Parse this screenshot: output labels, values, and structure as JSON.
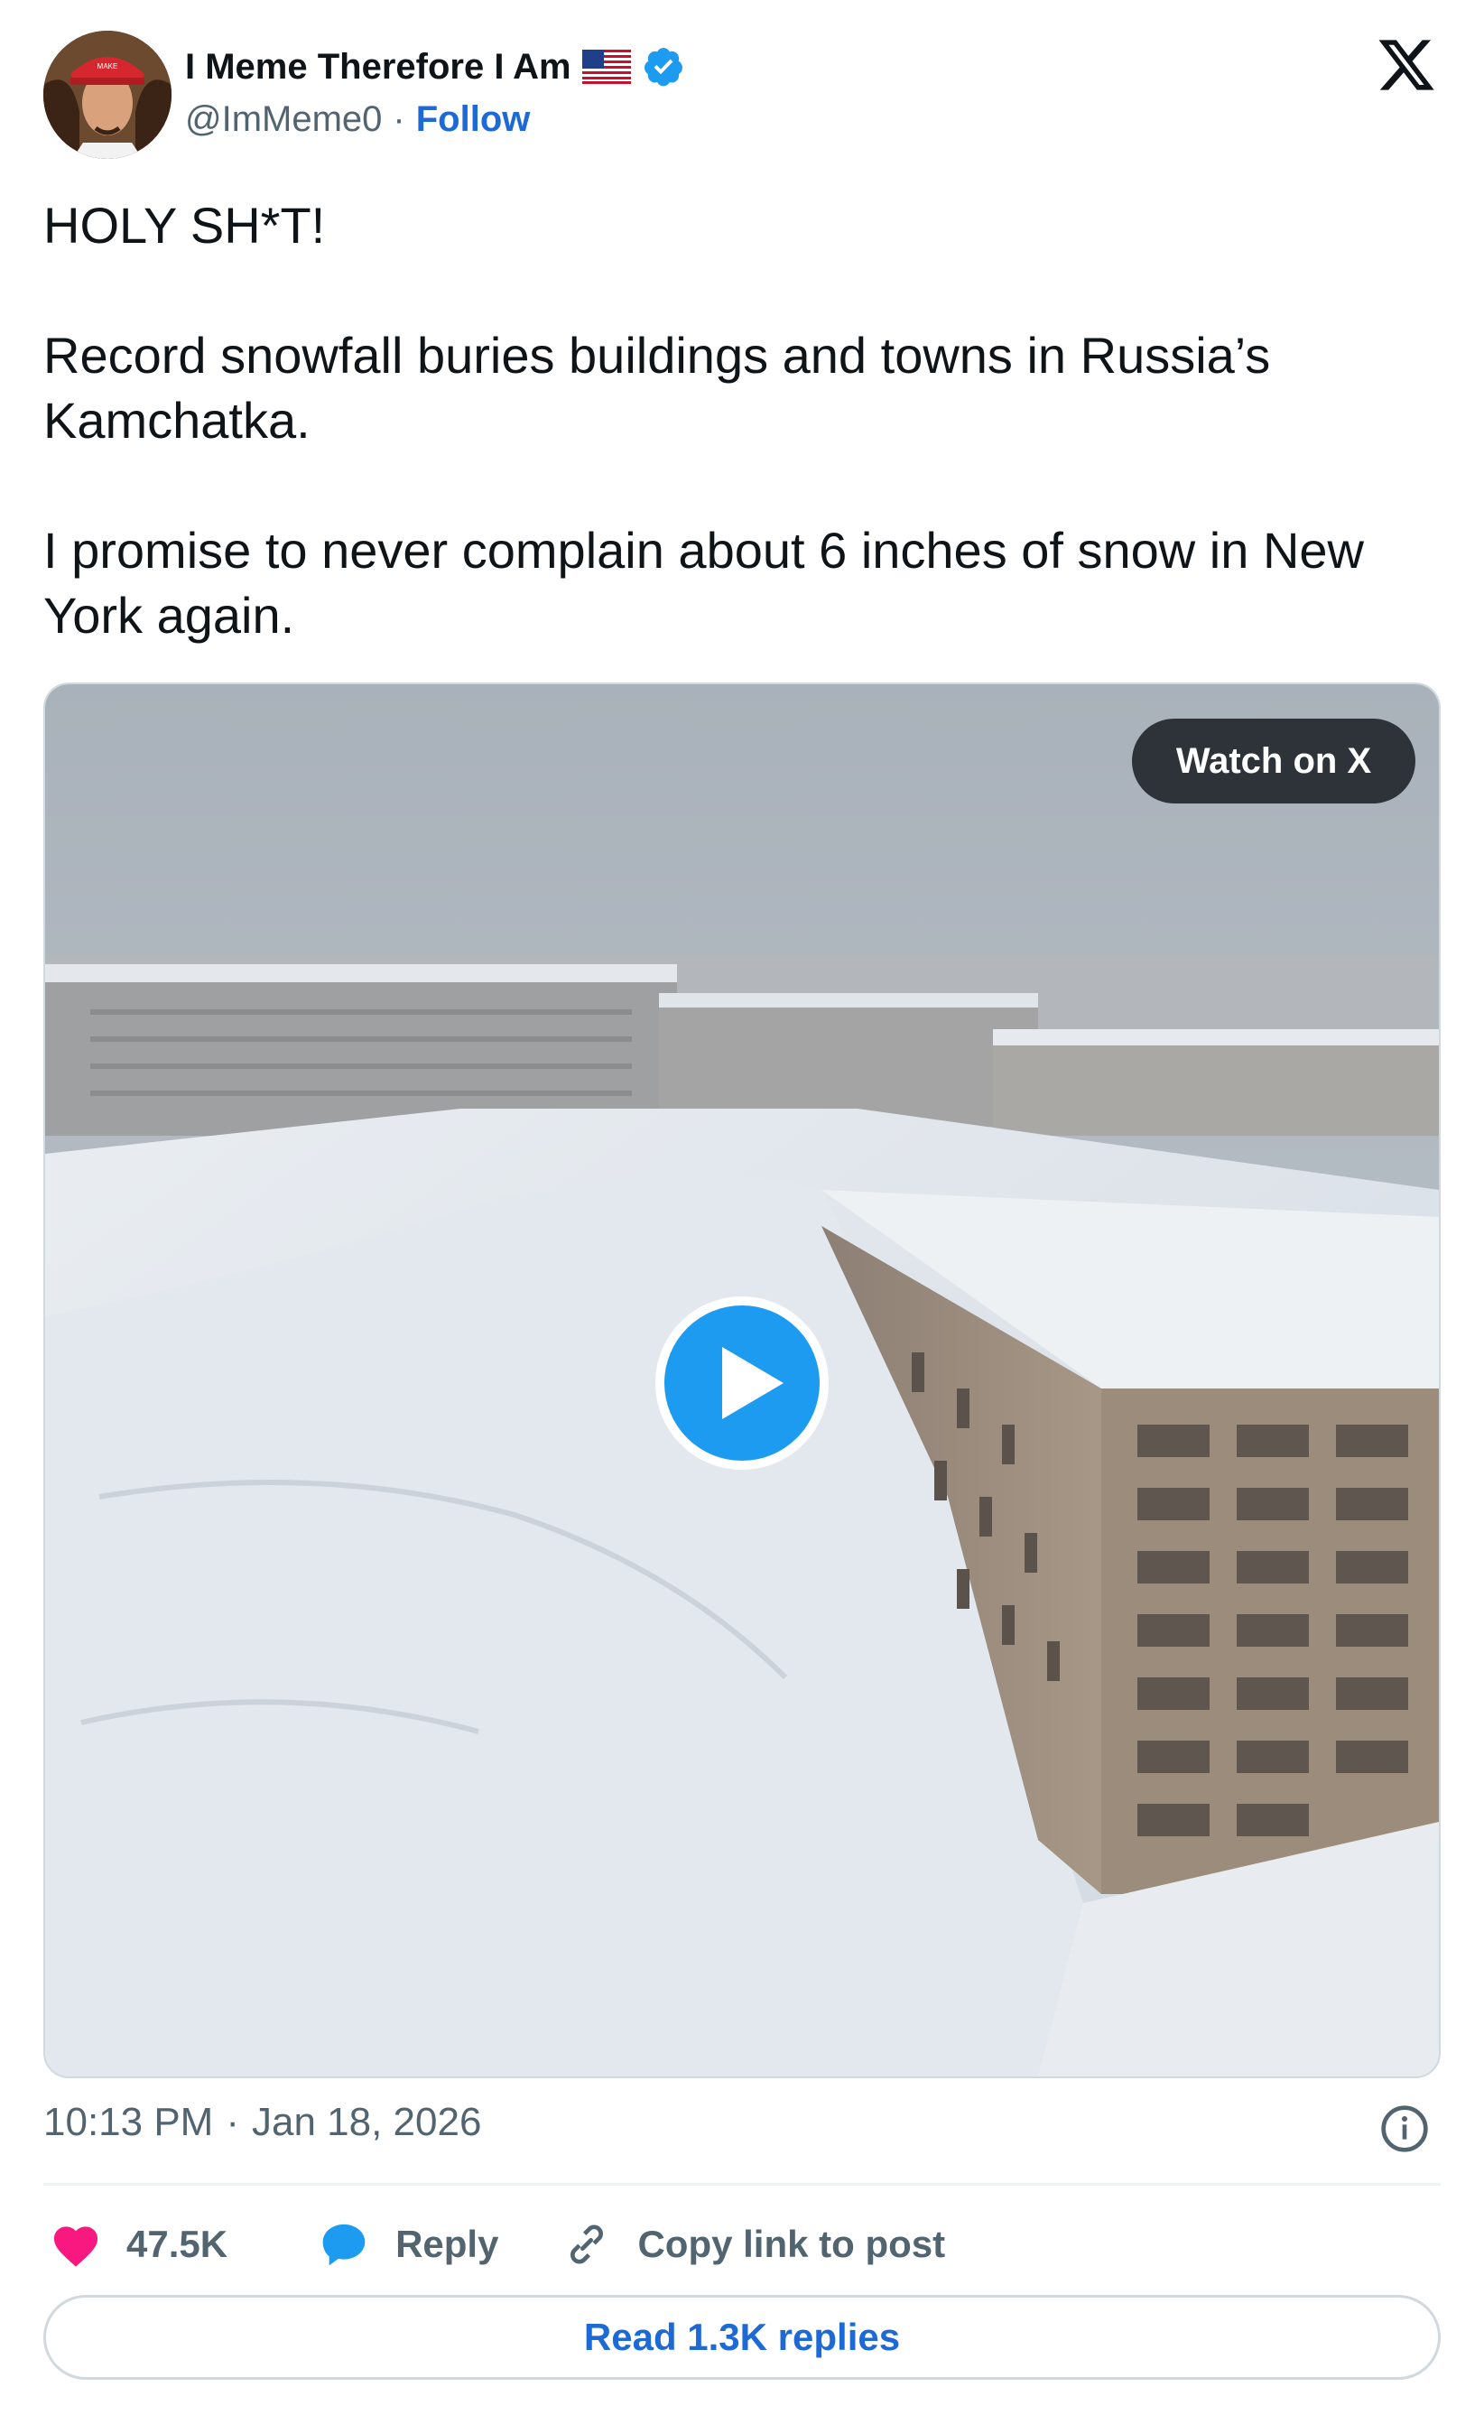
{
  "author": {
    "display_name": "I Meme Therefore I Am",
    "flag_icon": "us-flag-icon",
    "verified_icon": "verified-badge-icon",
    "handle": "@ImMeme0",
    "separator": "·",
    "follow_label": "Follow"
  },
  "brand": {
    "logo": "x-logo-icon"
  },
  "tweet": {
    "lines": [
      "HOLY SH*T!",
      "Record snowfall buries buildings and towns in Russia’s Kamchatka.",
      "I promise to never complain about 6 inches of snow in New York again."
    ]
  },
  "media": {
    "type": "video",
    "watch_label": "Watch on X",
    "play_icon": "play-icon"
  },
  "meta": {
    "time": "10:13 PM",
    "separator": "·",
    "date": "Jan 18, 2026",
    "info_icon": "info-icon"
  },
  "actions": {
    "like_count": "47.5K",
    "reply_label": "Reply",
    "copy_label": "Copy link to post",
    "read_replies_label": "Read 1.3K replies"
  },
  "colors": {
    "accent": "#1d6ad6",
    "like": "#f91880",
    "reply_icon": "#1d9bf0",
    "muted_text": "#536471",
    "watch_button_bg": "#2d3338"
  }
}
